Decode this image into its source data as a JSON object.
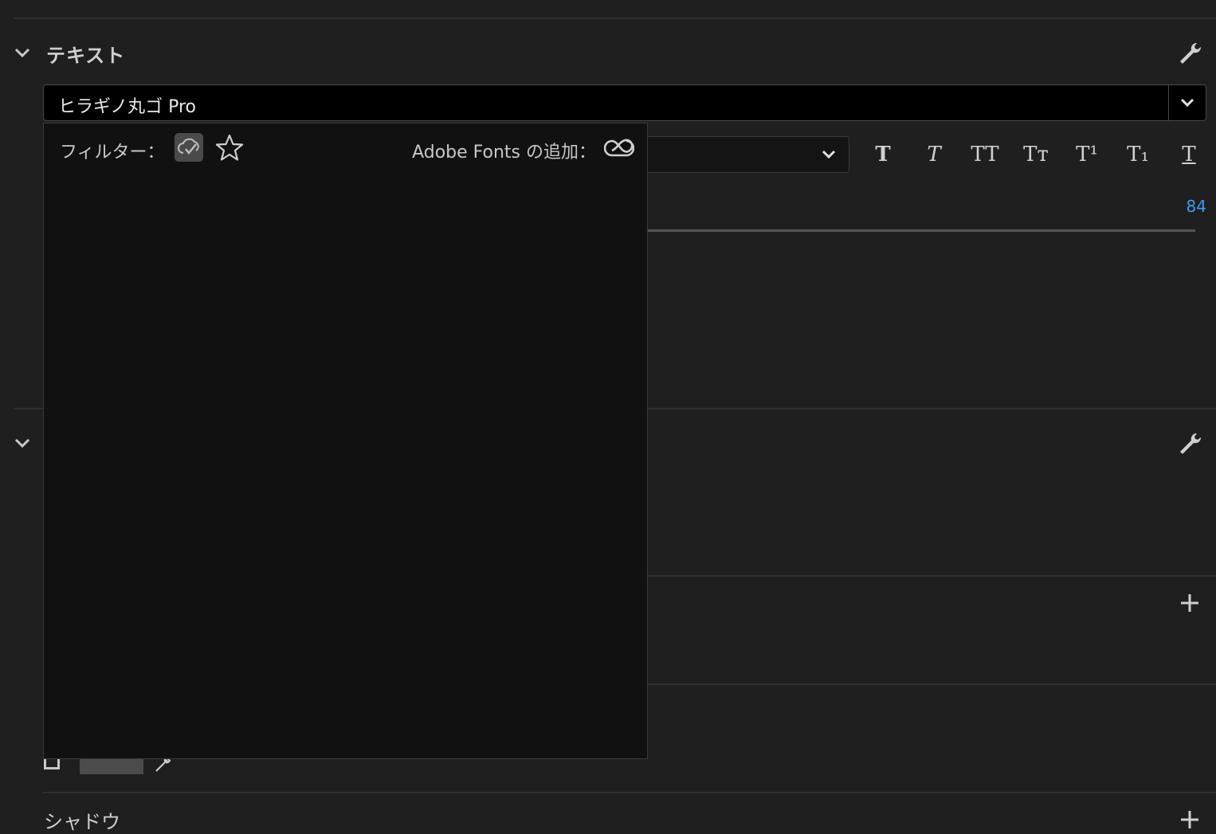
{
  "text_section": {
    "title": "テキスト",
    "font_value": "ヒラギノ丸ゴ Pro",
    "style_buttons": [
      {
        "label": "T",
        "style": "bold"
      },
      {
        "label": "T",
        "style": "italic"
      },
      {
        "label": "TT",
        "style": "all-caps"
      },
      {
        "label": "Tт",
        "style": "small-caps"
      },
      {
        "label": "T¹",
        "style": "superscript"
      },
      {
        "label": "T₁",
        "style": "subscript"
      },
      {
        "label": "T",
        "style": "underline"
      }
    ],
    "size_value": "84"
  },
  "font_dropdown": {
    "filter_label": "フィルター：",
    "adobe_fonts_label": "Adobe Fonts の追加："
  },
  "shadow_section": {
    "label": "シャドウ"
  },
  "colors": {
    "accent_blue": "#3d9bf4",
    "panel_bg": "#1f1f1f",
    "dropdown_bg": "#111111"
  }
}
